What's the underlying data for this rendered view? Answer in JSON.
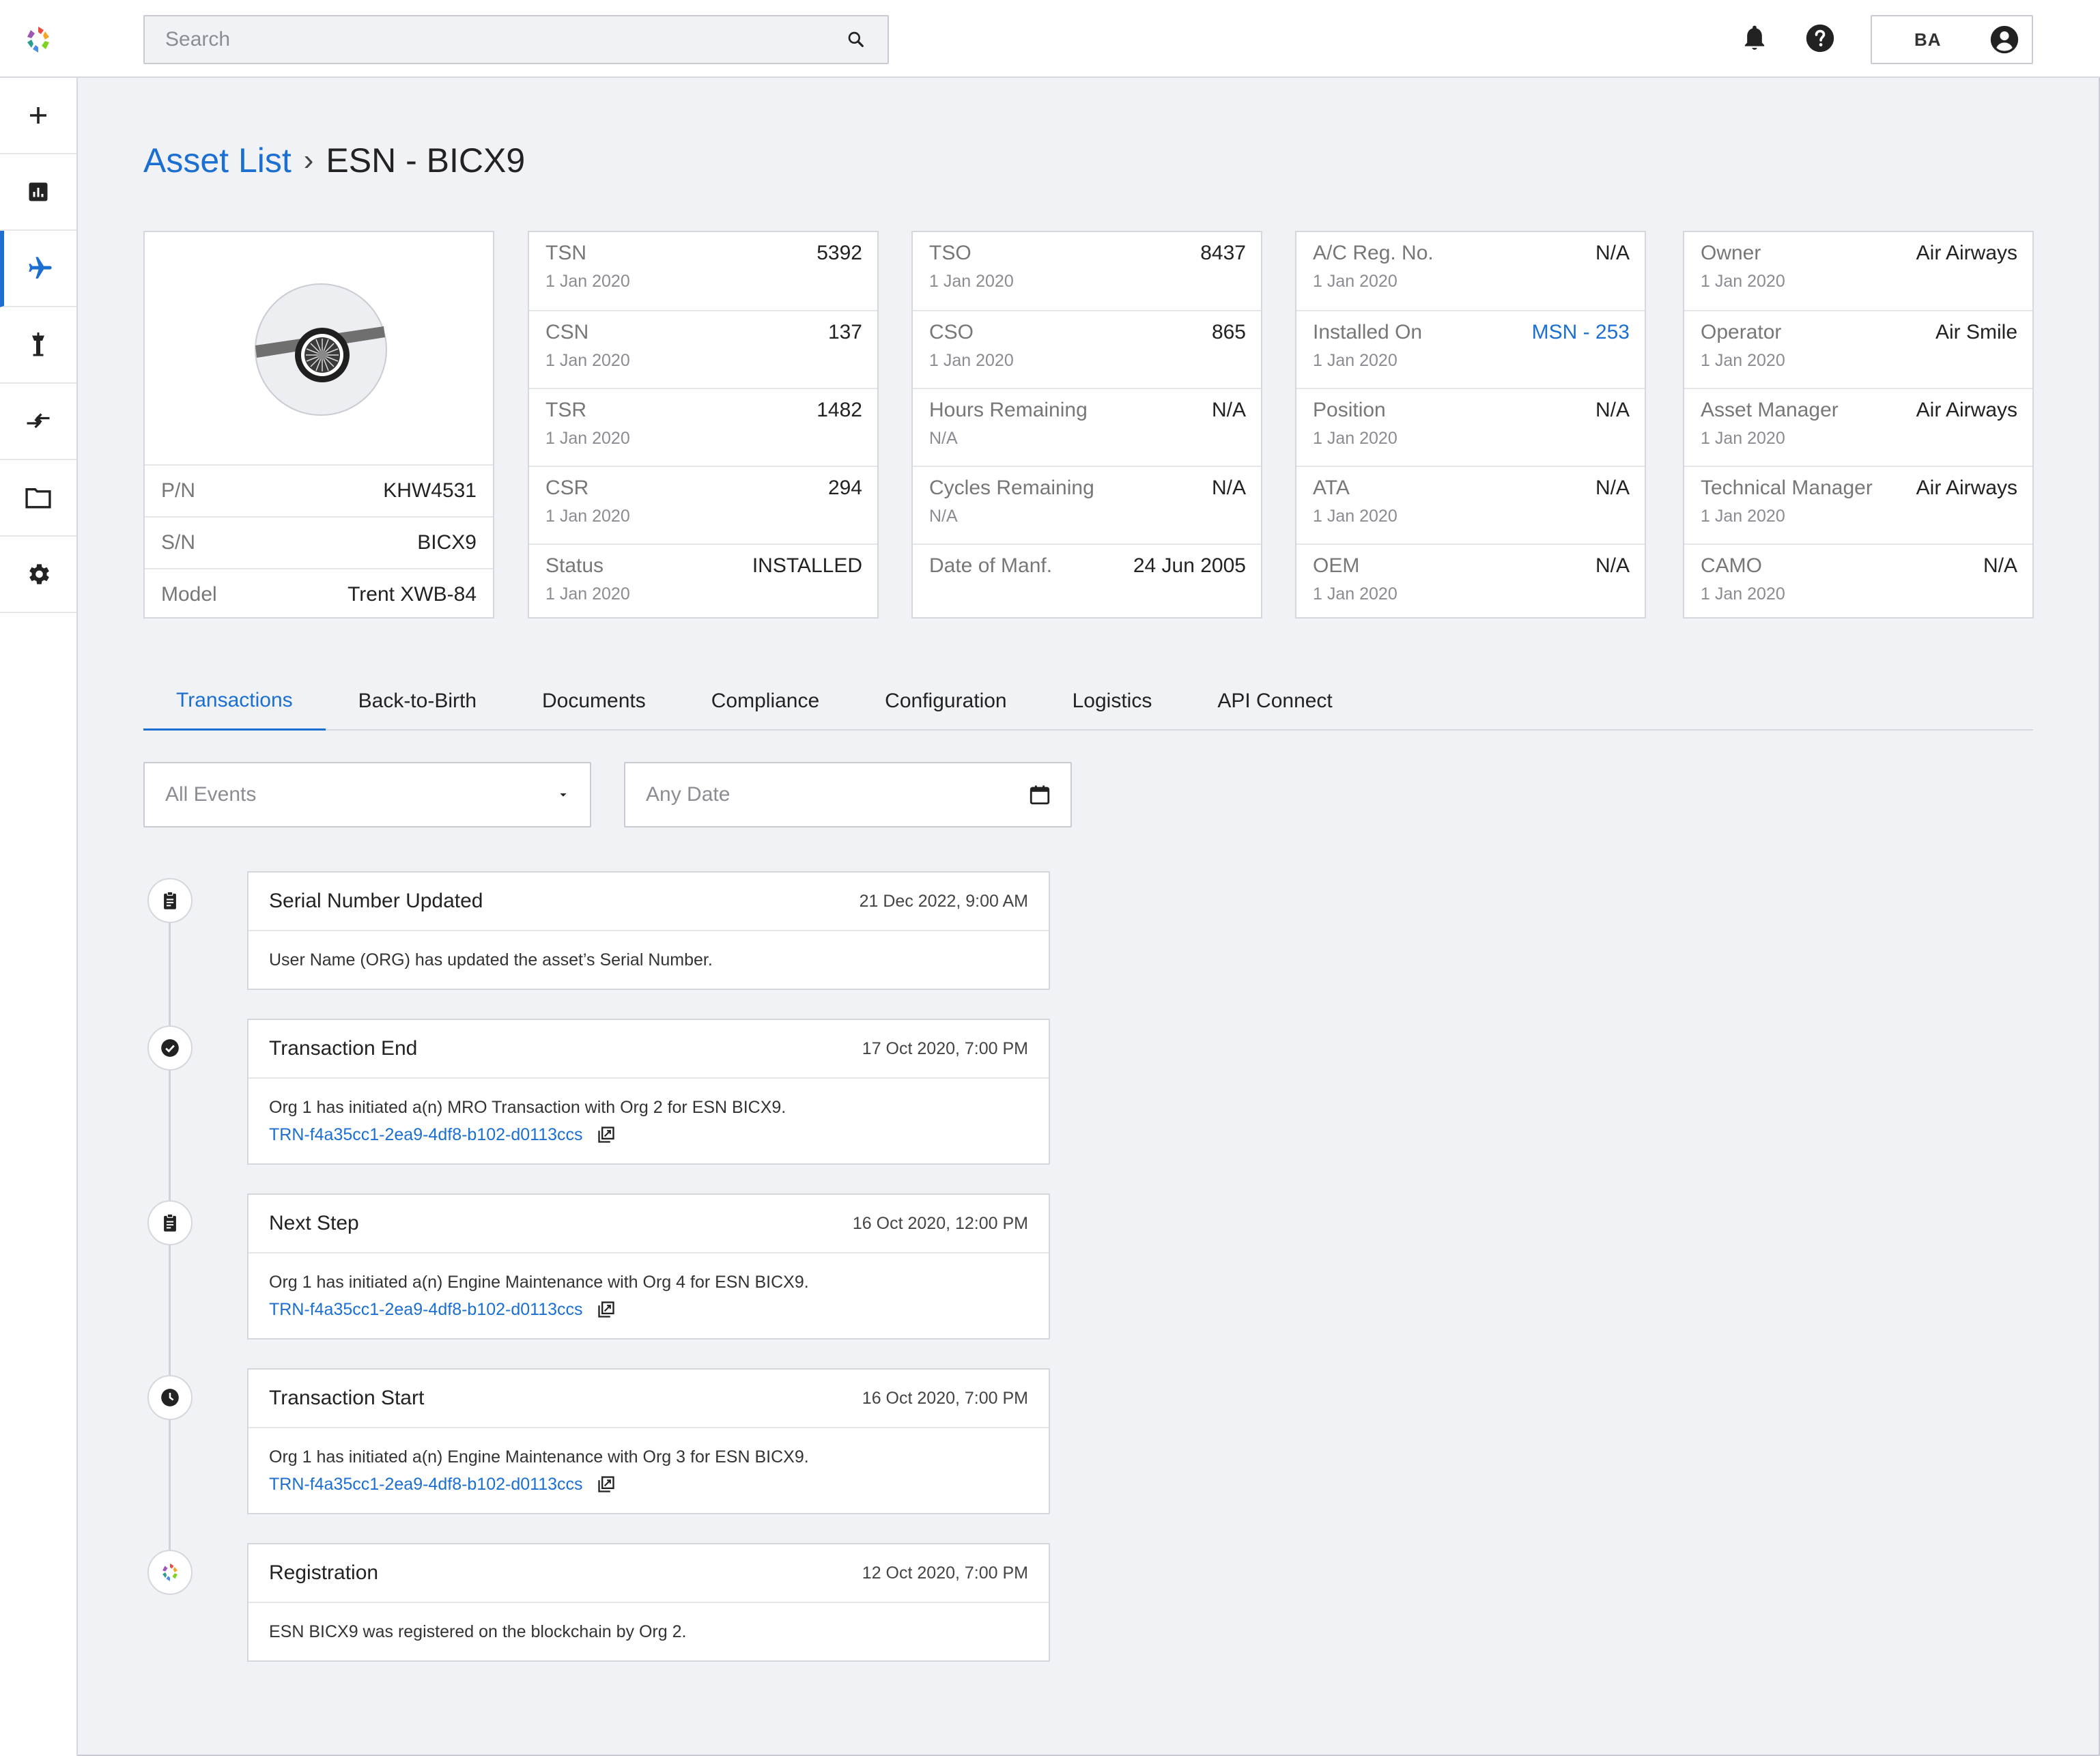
{
  "topbar": {
    "search_placeholder": "Search",
    "user_initials": "BA"
  },
  "sidebar": {
    "items": [
      {
        "icon": "plus-icon"
      },
      {
        "icon": "chart-icon"
      },
      {
        "icon": "plane-icon",
        "active": true
      },
      {
        "icon": "tower-icon"
      },
      {
        "icon": "transfer-icon"
      },
      {
        "icon": "folder-icon"
      },
      {
        "icon": "gear-icon"
      }
    ]
  },
  "breadcrumb": {
    "parent": "Asset List",
    "separator": "›",
    "current": "ESN - BICX9"
  },
  "asset": {
    "pn_label": "P/N",
    "pn": "KHW4531",
    "sn_label": "S/N",
    "sn": "BICX9",
    "model_label": "Model",
    "model": "Trent XWB-84"
  },
  "cards": [
    [
      {
        "label": "TSN",
        "value": "5392",
        "sub": "1 Jan 2020"
      },
      {
        "label": "CSN",
        "value": "137",
        "sub": "1 Jan 2020"
      },
      {
        "label": "TSR",
        "value": "1482",
        "sub": "1 Jan 2020"
      },
      {
        "label": "CSR",
        "value": "294",
        "sub": "1 Jan 2020"
      },
      {
        "label": "Status",
        "value": "INSTALLED",
        "sub": "1 Jan 2020"
      }
    ],
    [
      {
        "label": "TSO",
        "value": "8437",
        "sub": "1 Jan 2020"
      },
      {
        "label": "CSO",
        "value": "865",
        "sub": "1 Jan 2020"
      },
      {
        "label": "Hours Remaining",
        "value": "N/A",
        "sub": "N/A"
      },
      {
        "label": "Cycles Remaining",
        "value": "N/A",
        "sub": "N/A"
      },
      {
        "label": "Date of Manf.",
        "value": "24 Jun 2005",
        "sub": ""
      }
    ],
    [
      {
        "label": "A/C Reg. No.",
        "value": "N/A",
        "sub": "1 Jan 2020"
      },
      {
        "label": "Installed On",
        "value": "MSN - 253",
        "sub": "1 Jan 2020",
        "link": true
      },
      {
        "label": "Position",
        "value": "N/A",
        "sub": "1 Jan 2020"
      },
      {
        "label": "ATA",
        "value": "N/A",
        "sub": "1 Jan 2020"
      },
      {
        "label": "OEM",
        "value": "N/A",
        "sub": "1 Jan 2020"
      }
    ],
    [
      {
        "label": "Owner",
        "value": "Air Airways",
        "sub": "1 Jan 2020"
      },
      {
        "label": "Operator",
        "value": "Air Smile",
        "sub": "1 Jan 2020"
      },
      {
        "label": "Asset Manager",
        "value": "Air Airways",
        "sub": "1 Jan 2020"
      },
      {
        "label": "Technical Manager",
        "value": "Air Airways",
        "sub": "1 Jan 2020"
      },
      {
        "label": "CAMO",
        "value": "N/A",
        "sub": "1 Jan 2020"
      }
    ]
  ],
  "tabs": [
    "Transactions",
    "Back-to-Birth",
    "Documents",
    "Compliance",
    "Configuration",
    "Logistics",
    "API Connect"
  ],
  "filters": {
    "events": "All Events",
    "date": "Any Date"
  },
  "events": [
    {
      "icon": "clipboard-icon",
      "title": "Serial Number Updated",
      "date": "21 Dec 2022, 9:00 AM",
      "text": "User Name (ORG) has updated the asset’s Serial Number.",
      "trn": ""
    },
    {
      "icon": "check-circle-icon",
      "title": "Transaction End",
      "date": "17 Oct 2020, 7:00 PM",
      "text": "Org 1 has initiated a(n) MRO Transaction with Org 2 for ESN BICX9.",
      "trn": "TRN-f4a35cc1-2ea9-4df8-b102-d0113ccs"
    },
    {
      "icon": "clipboard-icon",
      "title": "Next Step",
      "date": "16 Oct 2020, 12:00 PM",
      "text": "Org 1 has initiated a(n) Engine Maintenance with Org 4 for ESN BICX9.",
      "trn": "TRN-f4a35cc1-2ea9-4df8-b102-d0113ccs"
    },
    {
      "icon": "clock-icon",
      "title": "Transaction Start",
      "date": "16 Oct 2020, 7:00 PM",
      "text": "Org 1 has initiated a(n) Engine Maintenance with Org 3 for ESN BICX9.",
      "trn": "TRN-f4a35cc1-2ea9-4df8-b102-d0113ccs"
    },
    {
      "icon": "app-logo-icon",
      "title": "Registration",
      "date": "12 Oct 2020, 7:00 PM",
      "text": "ESN BICX9 was registered on the blockchain by Org 2.",
      "trn": ""
    }
  ],
  "colors": {
    "accent": "#1a6fd1",
    "background": "#f1f2f6"
  }
}
